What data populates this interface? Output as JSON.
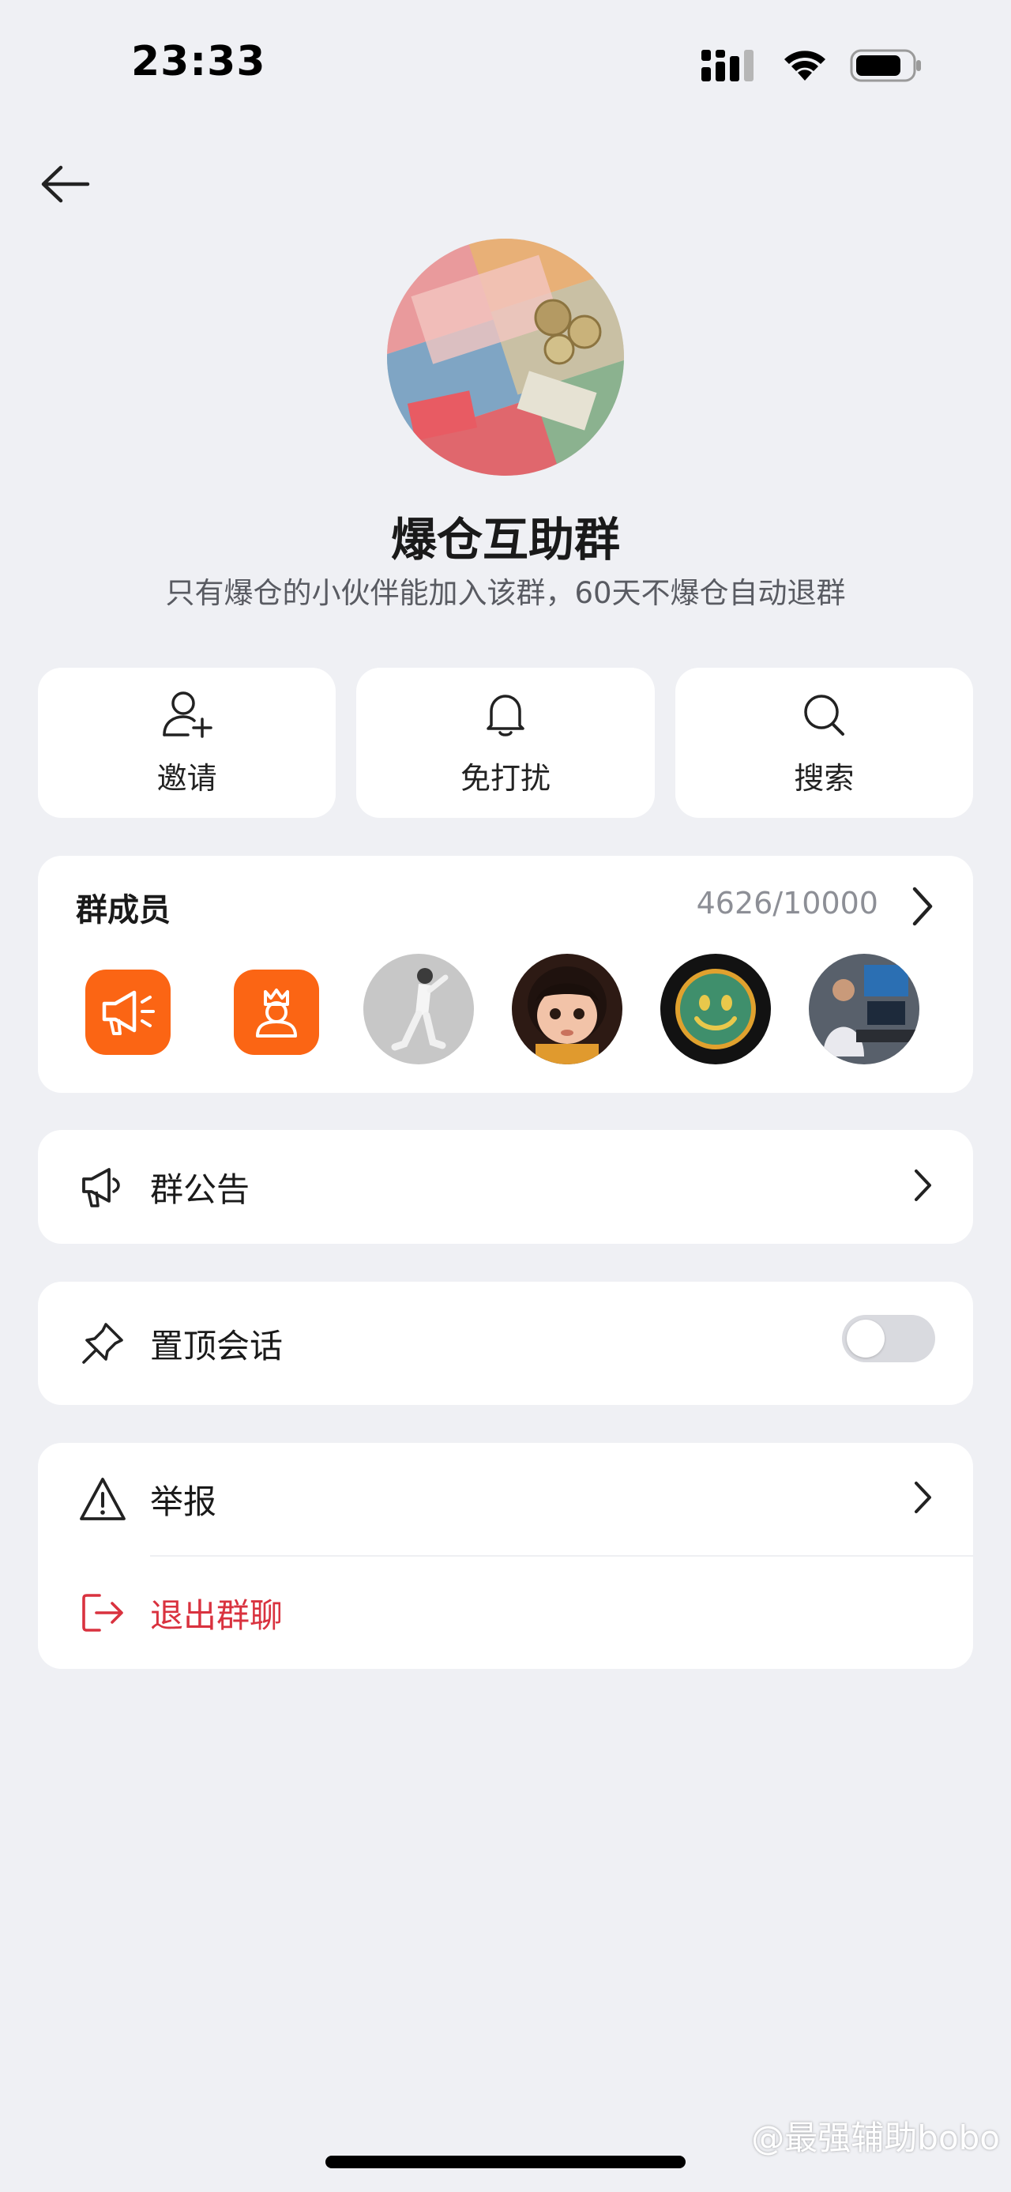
{
  "status_bar": {
    "time": "23:33",
    "battery_level": 0.75
  },
  "header": {
    "group_name": "爆仓互助群",
    "group_description": "只有爆仓的小伙伴能加入该群，60天不爆仓自动退群"
  },
  "actions": [
    {
      "label": "邀请",
      "icon": "add-user-icon"
    },
    {
      "label": "免打扰",
      "icon": "bell-icon"
    },
    {
      "label": "搜索",
      "icon": "search-icon"
    }
  ],
  "members": {
    "title": "群成员",
    "count": "4626/10000",
    "avatars": [
      "megaphone-icon",
      "admin-icon",
      "member-avatar",
      "member-avatar",
      "member-avatar",
      "member-avatar"
    ]
  },
  "announcement": {
    "label": "群公告",
    "icon": "megaphone-icon"
  },
  "pin_chat": {
    "label": "置顶会话",
    "icon": "pin-icon",
    "enabled": false
  },
  "report": {
    "label": "举报",
    "icon": "warning-icon"
  },
  "exit": {
    "label": "退出群聊",
    "icon": "exit-icon"
  },
  "watermark": "@最强辅助bobo",
  "colors": {
    "accent": "#fb6514",
    "danger": "#d9323f",
    "background": "#eff0f4"
  }
}
